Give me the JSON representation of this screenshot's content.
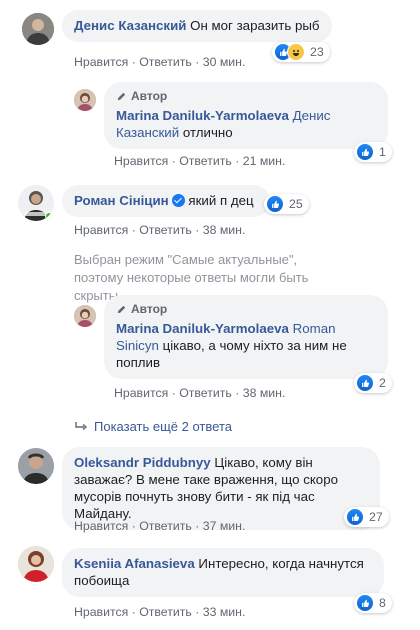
{
  "actions": {
    "like": "Нравится",
    "reply": "Ответить",
    "sep": "·"
  },
  "comments": [
    {
      "author": "Денис Казанский",
      "text": "Он мог заразить рыб",
      "time": "30 мин.",
      "reactions": {
        "icons": [
          "like-icon",
          "haha-icon"
        ],
        "count": "23"
      },
      "replies": [
        {
          "author_tag": "Автор",
          "author": "Marina Daniluk-Yarmolaeva",
          "mention": "Денис Казанский",
          "text": "отлично",
          "time": "21 мин.",
          "reactions": {
            "icons": [
              "like-icon"
            ],
            "count": "1"
          }
        }
      ]
    },
    {
      "author": "Роман Сініцин",
      "text": "який п  дец",
      "time": "38 мин.",
      "reactions": {
        "icons": [
          "like-icon"
        ],
        "count": "25"
      },
      "notice": "Выбран режим \"Самые актуальные\", поэтому некоторые ответы могли быть скрыты.",
      "replies": [
        {
          "author_tag": "Автор",
          "author": "Marina Daniluk-Yarmolaeva",
          "mention": "Roman Sinicyn",
          "text": "цікаво, а чому ніхто за ним не поплив",
          "time": "38 мин.",
          "reactions": {
            "icons": [
              "like-icon"
            ],
            "count": "2"
          }
        }
      ],
      "more_replies": "Показать ещё 2 ответа"
    },
    {
      "author": "Oleksandr Piddubnyy",
      "text": "Цікаво, кому він заважає? В мене таке враження, що скоро мусорів почнуть знову бити - як під час Майдану.",
      "time": "37 мин.",
      "reactions": {
        "icons": [
          "like-icon"
        ],
        "count": "27"
      }
    },
    {
      "author": "Kseniia Afanasieva",
      "text": "Интересно, когда начнутся побоища",
      "time": "33 мин.",
      "reactions": {
        "icons": [
          "like-icon"
        ],
        "count": "8"
      }
    }
  ],
  "colors": {
    "link": "#385898",
    "bubble": "#f2f3f5",
    "meta": "#606770",
    "like": "#1877f2"
  }
}
